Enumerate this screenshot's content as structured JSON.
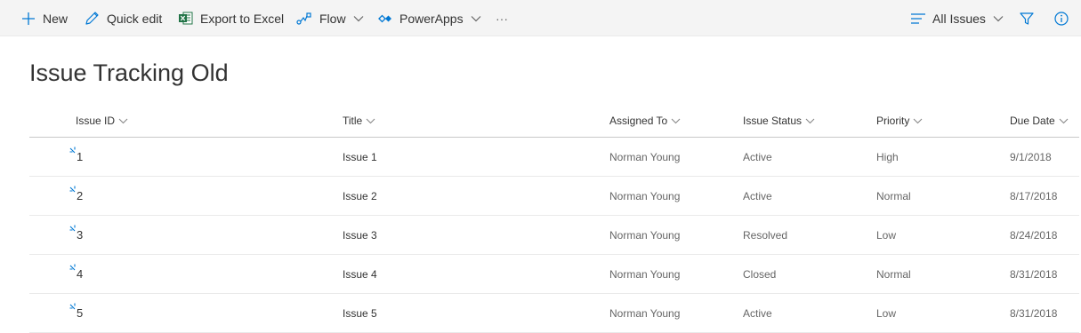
{
  "commandbar": {
    "new_label": "New",
    "quick_edit_label": "Quick edit",
    "export_label": "Export to Excel",
    "flow_label": "Flow",
    "powerapps_label": "PowerApps",
    "more_label": "···",
    "view_label": "All Issues"
  },
  "list": {
    "title": "Issue Tracking Old",
    "columns": {
      "issue_id": "Issue ID",
      "title": "Title",
      "assigned_to": "Assigned To",
      "issue_status": "Issue Status",
      "priority": "Priority",
      "due_date": "Due Date"
    },
    "rows": [
      {
        "id": "1",
        "title": "Issue 1",
        "assigned": "Norman Young",
        "status": "Active",
        "priority": "High",
        "due": "9/1/2018"
      },
      {
        "id": "2",
        "title": "Issue 2",
        "assigned": "Norman Young",
        "status": "Active",
        "priority": "Normal",
        "due": "8/17/2018"
      },
      {
        "id": "3",
        "title": "Issue 3",
        "assigned": "Norman Young",
        "status": "Resolved",
        "priority": "Low",
        "due": "8/24/2018"
      },
      {
        "id": "4",
        "title": "Issue 4",
        "assigned": "Norman Young",
        "status": "Closed",
        "priority": "Normal",
        "due": "8/31/2018"
      },
      {
        "id": "5",
        "title": "Issue 5",
        "assigned": "Norman Young",
        "status": "Active",
        "priority": "Low",
        "due": "8/31/2018"
      }
    ]
  },
  "colors": {
    "accent": "#0078d4",
    "excel": "#217346",
    "commandbar_bg": "#f4f4f4"
  },
  "icons": [
    "add-icon",
    "edit-icon",
    "excel-icon",
    "flow-icon",
    "powerapps-icon",
    "more-icon",
    "view-lines-icon",
    "filter-icon",
    "info-icon",
    "new-item-icon",
    "chevron-down-icon"
  ]
}
